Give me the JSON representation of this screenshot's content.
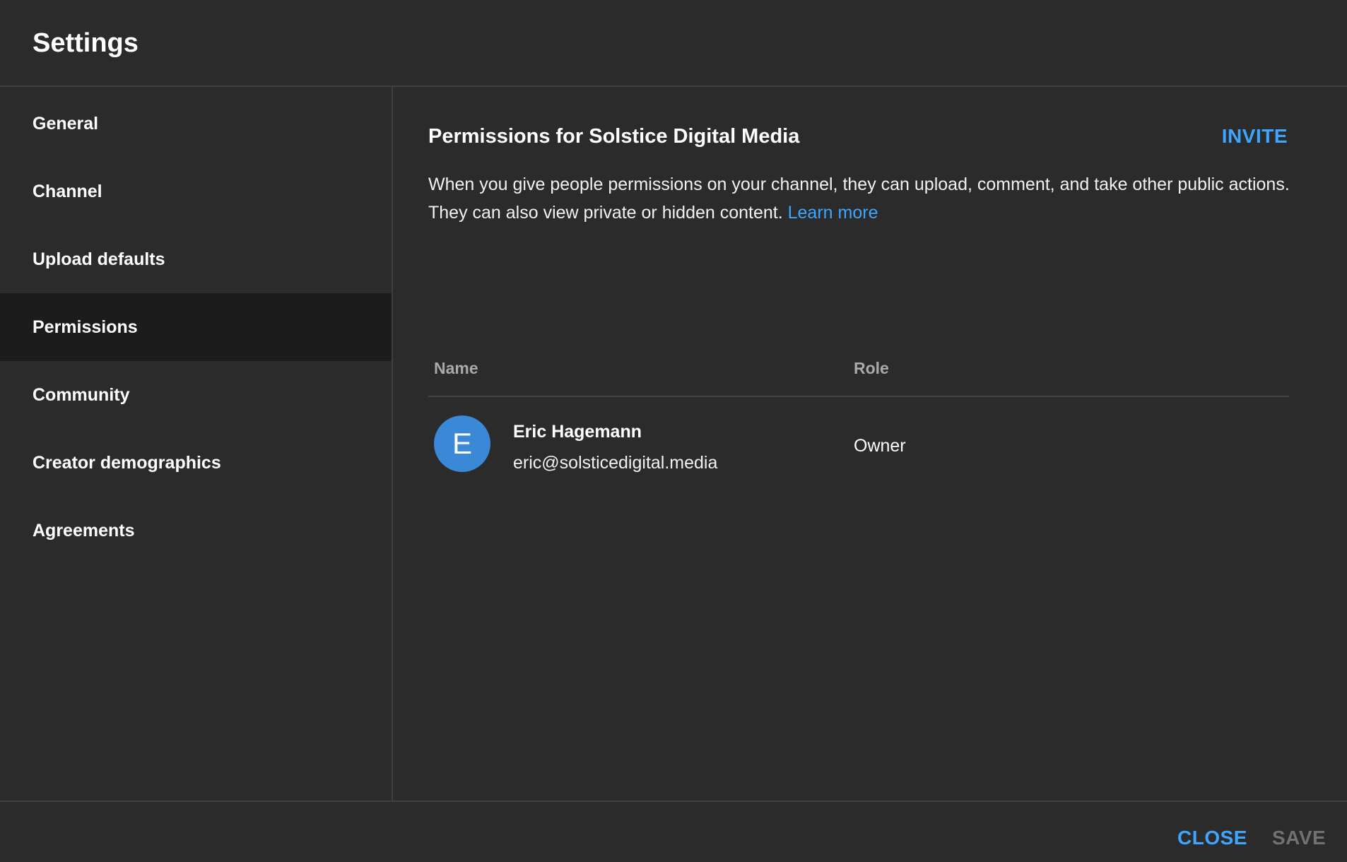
{
  "header": {
    "title": "Settings"
  },
  "sidebar": {
    "items": [
      {
        "label": "General",
        "active": false
      },
      {
        "label": "Channel",
        "active": false
      },
      {
        "label": "Upload defaults",
        "active": false
      },
      {
        "label": "Permissions",
        "active": true
      },
      {
        "label": "Community",
        "active": false
      },
      {
        "label": "Creator demographics",
        "active": false
      },
      {
        "label": "Agreements",
        "active": false
      }
    ]
  },
  "permissions": {
    "title": "Permissions for Solstice Digital Media",
    "invite_label": "INVITE",
    "description": "When you give people permissions on your channel, they can upload, comment, and take other public actions. They can also view private or hidden content.",
    "learn_more": "Learn more",
    "table": {
      "columns": [
        "Name",
        "Role"
      ],
      "rows": [
        {
          "avatar_initial": "E",
          "name": "Eric Hagemann",
          "email": "eric@solsticedigital.media",
          "role": "Owner"
        }
      ]
    }
  },
  "footer": {
    "close_label": "CLOSE",
    "save_label": "SAVE",
    "save_enabled": false
  },
  "colors": {
    "background": "#2b2b2b",
    "active_item": "#1c1c1c",
    "accent": "#3ea6ff",
    "avatar": "#3a88d6",
    "disabled": "#717171"
  }
}
